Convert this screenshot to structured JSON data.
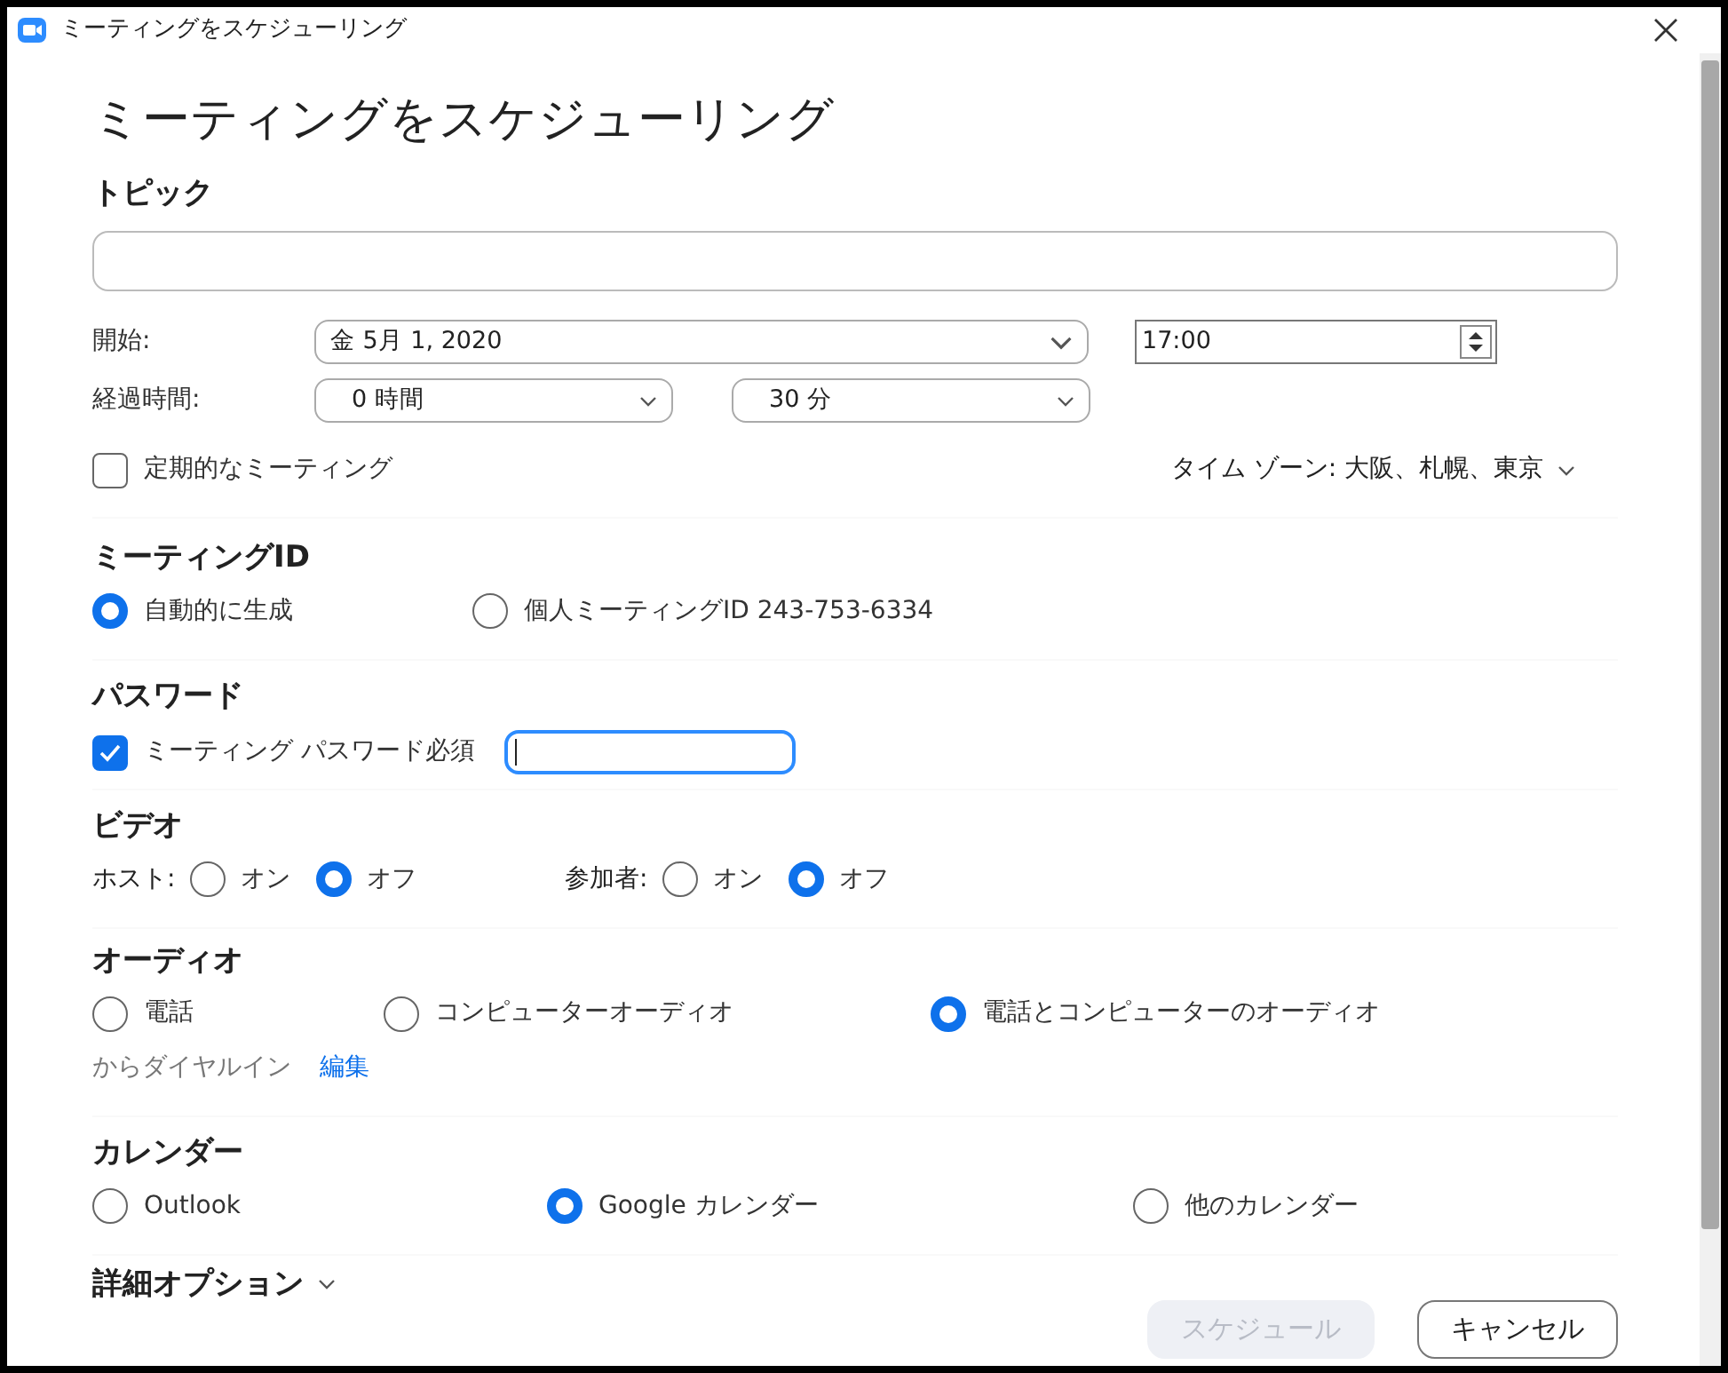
{
  "window": {
    "title": "ミーティングをスケジューリング"
  },
  "heading": "ミーティングをスケジューリング",
  "topic": {
    "label": "トピック"
  },
  "start": {
    "label": "開始:",
    "date": "金  5月 1, 2020",
    "time": "17:00"
  },
  "duration": {
    "label": "経過時間:",
    "hours": "0 時間",
    "minutes": "30 分"
  },
  "recurring": {
    "label": "定期的なミーティング",
    "checked": false
  },
  "timezone": "タイム ゾーン: 大阪、札幌、東京",
  "meeting_id": {
    "title": "ミーティングID",
    "options": [
      {
        "label": "自動的に生成",
        "selected": true
      },
      {
        "label": "個人ミーティングID 243-753-6334",
        "selected": false
      }
    ]
  },
  "password": {
    "title": "パスワード",
    "label": "ミーティング パスワード必須",
    "checked": true
  },
  "video": {
    "title": "ビデオ",
    "groups": [
      {
        "label": "ホスト:",
        "options": [
          {
            "label": "オン",
            "selected": false
          },
          {
            "label": "オフ",
            "selected": true
          }
        ]
      },
      {
        "label": "参加者:",
        "options": [
          {
            "label": "オン",
            "selected": false
          },
          {
            "label": "オフ",
            "selected": true
          }
        ]
      }
    ]
  },
  "audio": {
    "title": "オーディオ",
    "options": [
      {
        "label": "電話",
        "selected": false
      },
      {
        "label": "コンピューターオーディオ",
        "selected": false
      },
      {
        "label": "電話とコンピューターのオーディオ",
        "selected": true
      }
    ],
    "dial_in": "からダイヤルイン",
    "edit_link": "編集"
  },
  "calendar": {
    "title": "カレンダー",
    "options": [
      {
        "label": "Outlook",
        "selected": false
      },
      {
        "label": "Google カレンダー",
        "selected": true
      },
      {
        "label": "他のカレンダー",
        "selected": false
      }
    ]
  },
  "advanced": {
    "label": "詳細オプション",
    "expanded": false
  },
  "buttons": [
    {
      "label": "スケジュール",
      "disabled": true
    },
    {
      "label": "キャンセル",
      "disabled": false
    }
  ]
}
